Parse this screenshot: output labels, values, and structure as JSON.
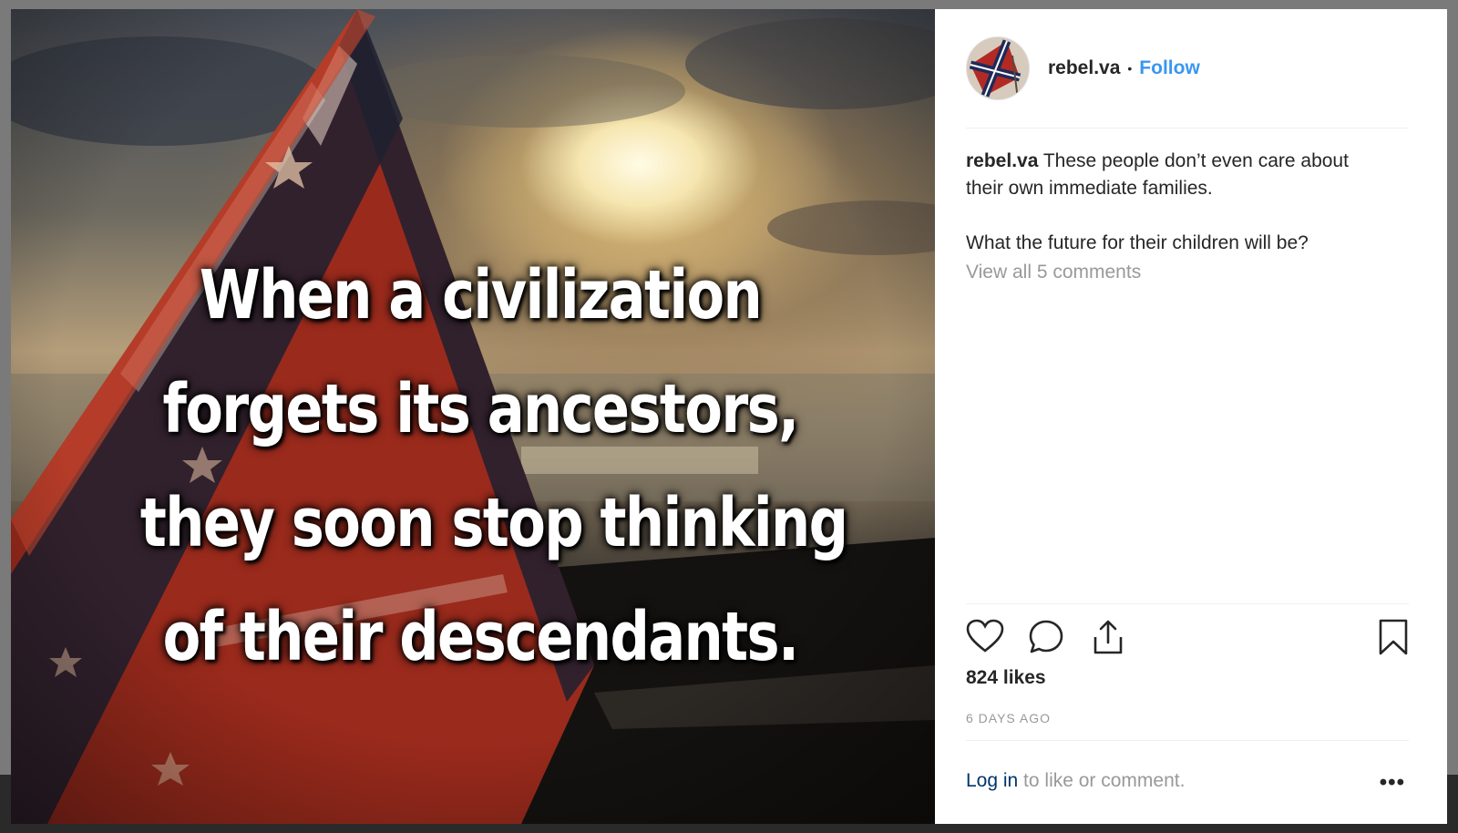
{
  "post": {
    "image_quote": {
      "line1": "When a civilization",
      "line2": "forgets its ancestors,",
      "line3": "they soon stop thinking",
      "line4": "of their descendants."
    },
    "header": {
      "username": "rebel.va",
      "separator": "•",
      "follow_label": "Follow"
    },
    "caption": {
      "username": "rebel.va",
      "text_line1": "These people don’t even care about their own immediate families.",
      "text_line2": "What the future for their children will be?"
    },
    "view_comments": "View all 5 comments",
    "likes": "824 likes",
    "timestamp": "6 DAYS AGO",
    "footer": {
      "login_link": "Log in",
      "login_rest": " to like or comment.",
      "more": "•••"
    }
  },
  "icons": {
    "like": "heart-icon",
    "comment": "comment-icon",
    "share": "share-icon",
    "save": "bookmark-icon",
    "more": "more-options-icon"
  },
  "colors": {
    "link": "#3897f0",
    "text": "#262626",
    "muted": "#999999",
    "login_link": "#003569"
  }
}
